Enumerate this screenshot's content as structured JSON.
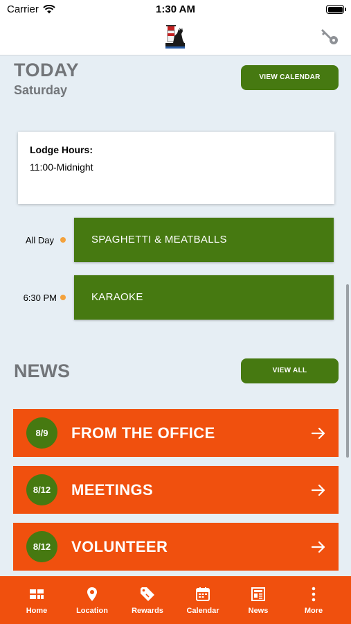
{
  "status": {
    "carrier": "Carrier",
    "time": "1:30 AM"
  },
  "today": {
    "title": "TODAY",
    "day": "Saturday",
    "view_calendar_label": "VIEW CALENDAR"
  },
  "hours": {
    "label": "Lodge Hours:",
    "value": "11:00-Midnight"
  },
  "events": [
    {
      "time": "All Day",
      "name": "SPAGHETTI & MEATBALLS"
    },
    {
      "time": "6:30 PM",
      "name": "KARAOKE"
    }
  ],
  "news": {
    "title": "NEWS",
    "view_all_label": "VIEW ALL",
    "items": [
      {
        "date": "8/9",
        "label": "FROM THE OFFICE"
      },
      {
        "date": "8/12",
        "label": "MEETINGS"
      },
      {
        "date": "8/12",
        "label": "VOLUNTEER"
      }
    ]
  },
  "tabs": [
    {
      "label": "Home",
      "icon": "home-grid-icon"
    },
    {
      "label": "Location",
      "icon": "map-pin-icon"
    },
    {
      "label": "Rewards",
      "icon": "tag-icon"
    },
    {
      "label": "Calendar",
      "icon": "calendar-icon"
    },
    {
      "label": "News",
      "icon": "newspaper-icon"
    },
    {
      "label": "More",
      "icon": "more-dots-icon"
    }
  ],
  "colors": {
    "accent_green": "#467911",
    "accent_orange": "#f0500e",
    "background": "#e6eef4",
    "event_dot": "#f4a23c"
  }
}
